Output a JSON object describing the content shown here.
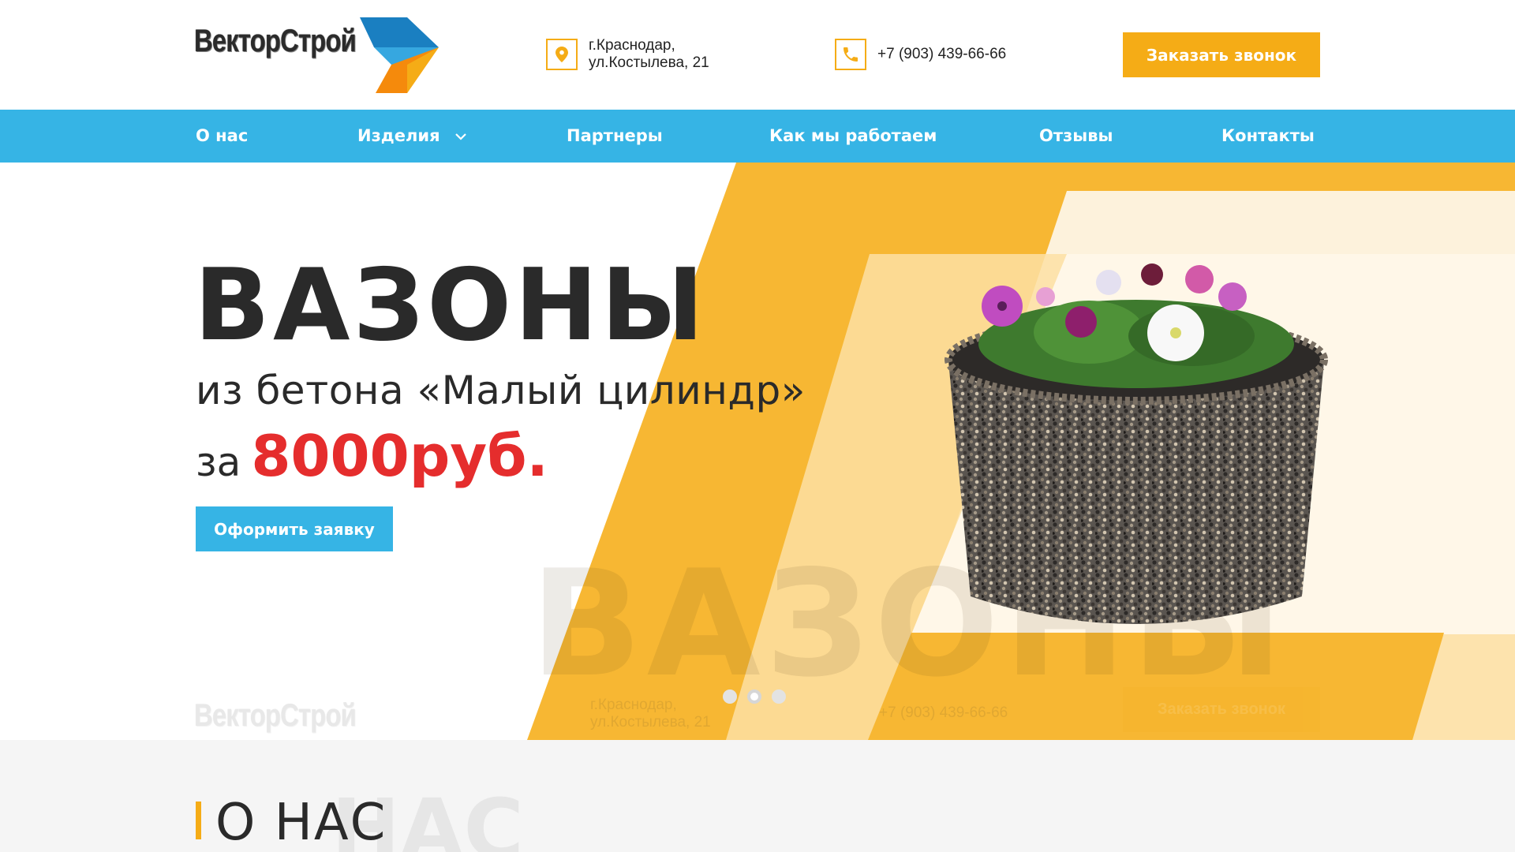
{
  "header": {
    "logo_text": "ВекторСтрой",
    "address": [
      "г.Краснодар,",
      "ул.Костылева, 21"
    ],
    "phone": "+7 (903) 439-66-66",
    "call_button": "Заказать звонок"
  },
  "nav": {
    "items": [
      "О нас",
      "Изделия",
      "Партнеры",
      "Как мы работаем",
      "Отзывы",
      "Контакты"
    ]
  },
  "hero": {
    "title": "ВАЗОНЫ",
    "subtitle": "из бетона «Малый цилиндр»",
    "price_prefix": "за",
    "price": "8000руб.",
    "order_button": "Оформить заявку",
    "watermark": "ВАЗОНЫ",
    "slide_count": 3,
    "active_slide": 2
  },
  "about": {
    "title": "О НАС",
    "watermark": "НАС"
  },
  "colors": {
    "accent": "#f5ac16",
    "nav": "#36b4e5",
    "price": "#e52d2d"
  },
  "icons": [
    "location-pin-icon",
    "phone-icon",
    "chevron-down-icon"
  ]
}
